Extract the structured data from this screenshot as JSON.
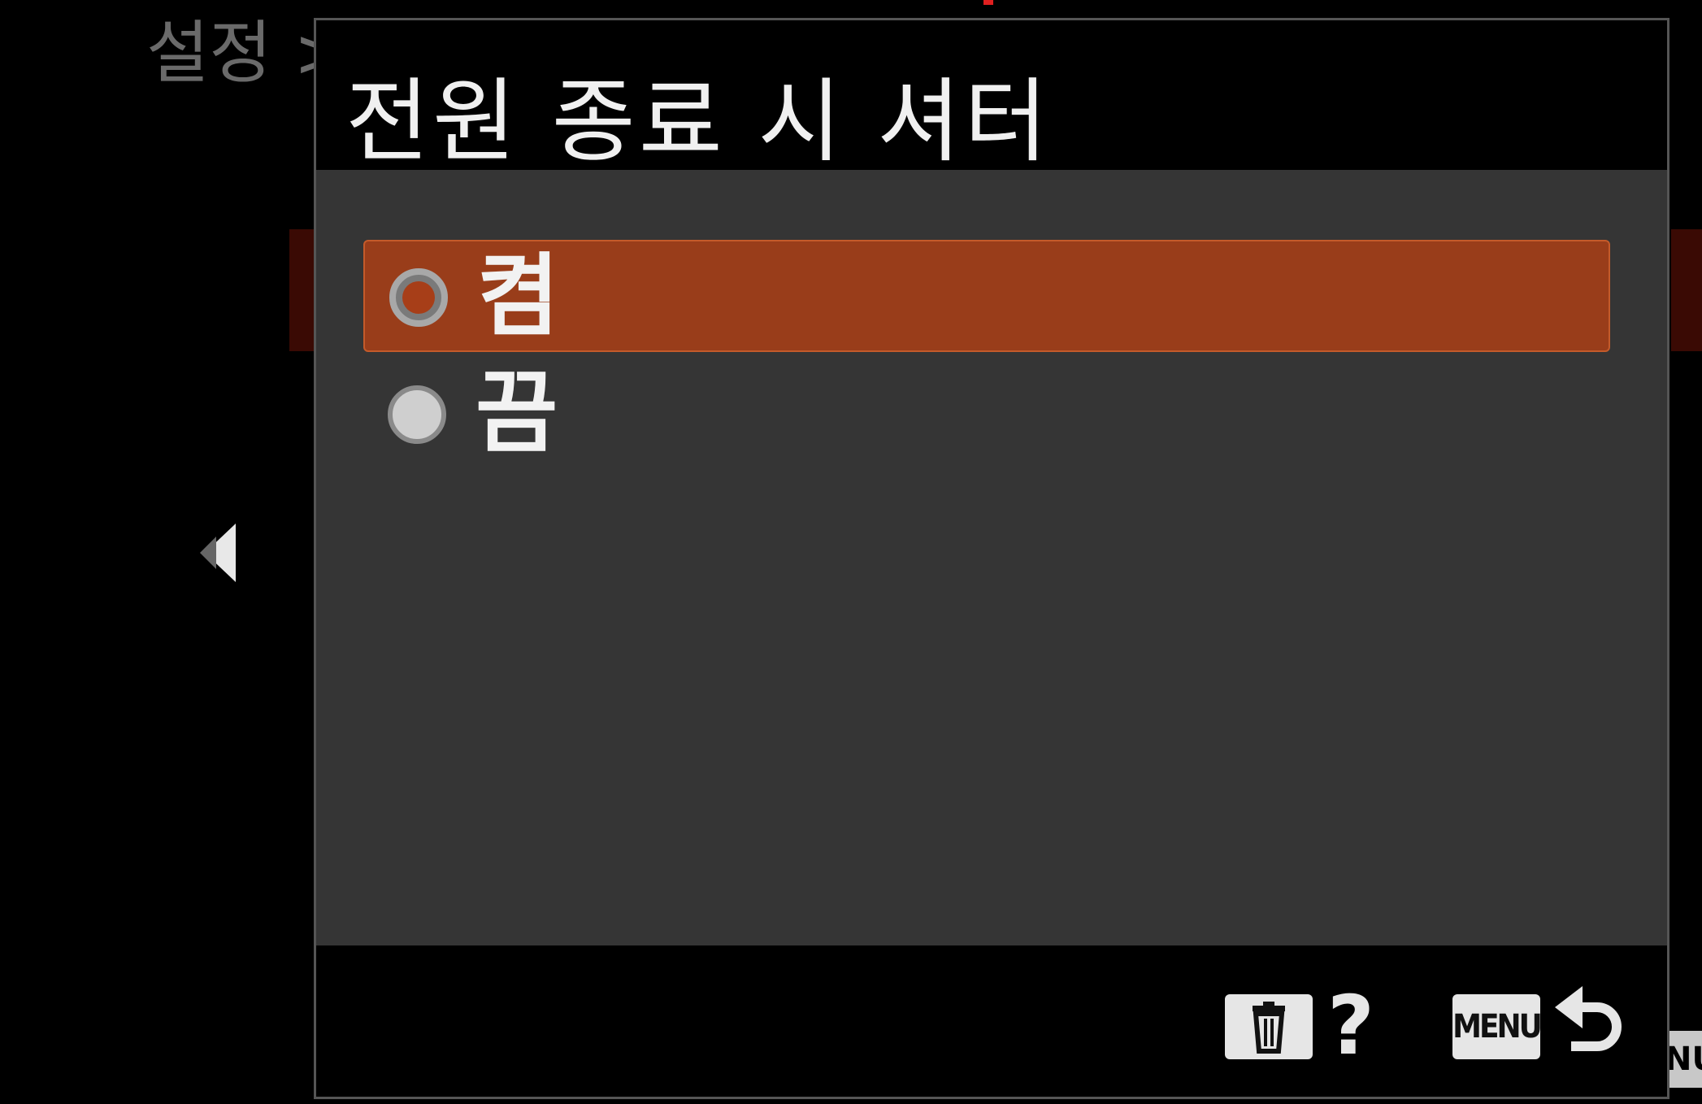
{
  "background": {
    "breadcrumb": "설정 >",
    "left_arrow_icon": "left-arrow-icon",
    "menu_fragment": "NU"
  },
  "dialog": {
    "title": "전원 종료 시 셔터",
    "options": [
      {
        "label": "켬",
        "selected": true
      },
      {
        "label": "끔",
        "selected": false
      }
    ],
    "footer": {
      "delete_icon": "trash-icon",
      "help_label": "?",
      "menu_label": "MENU",
      "back_icon": "return-arrow-icon"
    }
  },
  "colors": {
    "selected_bg": "#993d1a",
    "panel_bg": "#353535",
    "text": "#f2f2f2"
  }
}
